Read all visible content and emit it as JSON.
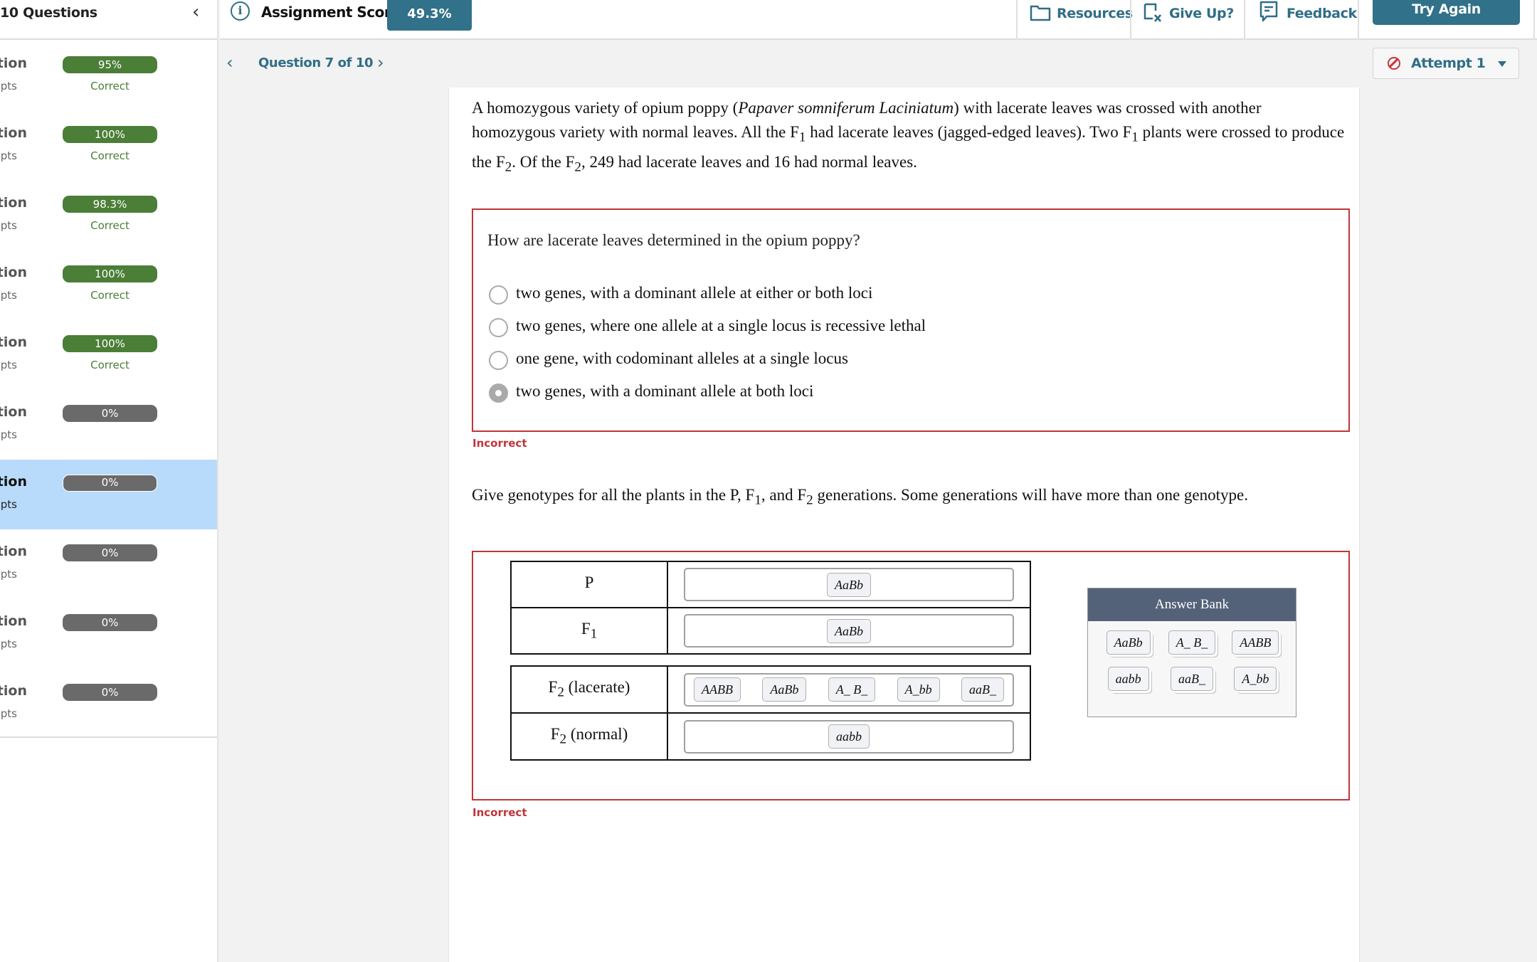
{
  "sidebar": {
    "title": "10 Questions",
    "collapse_icon": "chevron-left-icon",
    "items": [
      {
        "label": "Question",
        "sub": "Attempts",
        "score": "95%",
        "status": "Correct",
        "state": "correct"
      },
      {
        "label": "Question",
        "sub": "Attempts",
        "score": "100%",
        "status": "Correct",
        "state": "correct"
      },
      {
        "label": "Question",
        "sub": "Attempts",
        "score": "98.3%",
        "status": "Correct",
        "state": "correct"
      },
      {
        "label": "Question",
        "sub": "Attempts",
        "score": "100%",
        "status": "Correct",
        "state": "correct"
      },
      {
        "label": "Question",
        "sub": "Attempts",
        "score": "100%",
        "status": "Correct",
        "state": "correct"
      },
      {
        "label": "Question",
        "sub": "Attempts",
        "score": "0%",
        "status": "",
        "state": "none"
      },
      {
        "label": "Question",
        "sub": "Attempts",
        "score": "0%",
        "status": "",
        "state": "active"
      },
      {
        "label": "Question",
        "sub": "Attempts",
        "score": "0%",
        "status": "",
        "state": "none"
      },
      {
        "label": "Question",
        "sub": "Attempts",
        "score": "0%",
        "status": "",
        "state": "none"
      },
      {
        "label": "Question",
        "sub": "Attempts",
        "score": "0%",
        "status": "",
        "state": "none"
      }
    ]
  },
  "header": {
    "score_label": "Assignment Score:",
    "score_value": "49.3%",
    "resources": "Resources",
    "give_up": "Give Up?",
    "feedback": "Feedback",
    "try_again": "Try Again"
  },
  "nav": {
    "question_label": "Question 7 of 10",
    "attempt_label": "Attempt 1"
  },
  "colors": {
    "brand": "#317189",
    "correct": "#4b7e37",
    "zero": "#6a6a6a",
    "incorrect": "#c0353a",
    "active_row": "#b9dbfb",
    "bank_header": "#546279"
  },
  "question": {
    "intro_parts": {
      "a": "A homozygous variety of opium poppy (",
      "species": "Papaver somniferum Laciniatum",
      "b": ") with lacerate leaves was crossed with another homozygous variety with normal leaves. All the F",
      "sub1": "1",
      "c": " had lacerate leaves (jagged-edged leaves). Two F",
      "sub2": "1",
      "d": " plants were crossed to produce the F",
      "sub3": "2",
      "e": ". Of the F",
      "sub4": "2",
      "f": ", 249 had lacerate leaves and 16 had normal leaves."
    },
    "part1": {
      "prompt": "How are lacerate leaves determined in the opium poppy?",
      "options": [
        {
          "text": "two genes, with a dominant allele at either or both loci",
          "selected": false
        },
        {
          "text": "two genes, where one allele at a single locus is recessive lethal",
          "selected": false
        },
        {
          "text": "one gene, with codominant alleles at a single locus",
          "selected": false
        },
        {
          "text": "two genes, with a dominant allele at both loci",
          "selected": true
        }
      ],
      "result": "Incorrect"
    },
    "part2": {
      "prompt_parts": {
        "a": "Give genotypes for all the plants in the P, F",
        "sub1": "1",
        "b": ", and F",
        "sub2": "2",
        "c": " generations. Some generations will have more than one genotype."
      },
      "rows": [
        {
          "label": "P",
          "label_sub": "",
          "label_suffix": "",
          "chips": [
            "AaBb"
          ]
        },
        {
          "label": "F",
          "label_sub": "1",
          "label_suffix": "",
          "chips": [
            "AaBb"
          ]
        },
        {
          "label": "F",
          "label_sub": "2",
          "label_suffix": " (lacerate)",
          "chips": [
            "AABB",
            "AaBb",
            "A_ B_",
            "A_bb",
            "aaB_"
          ]
        },
        {
          "label": "F",
          "label_sub": "2",
          "label_suffix": " (normal)",
          "chips": [
            "aabb"
          ]
        }
      ],
      "answer_bank": {
        "title": "Answer Bank",
        "chips": [
          "AaBb",
          "A_ B_",
          "AABB",
          "aabb",
          "aaB_",
          "A_bb"
        ]
      },
      "result": "Incorrect"
    }
  }
}
